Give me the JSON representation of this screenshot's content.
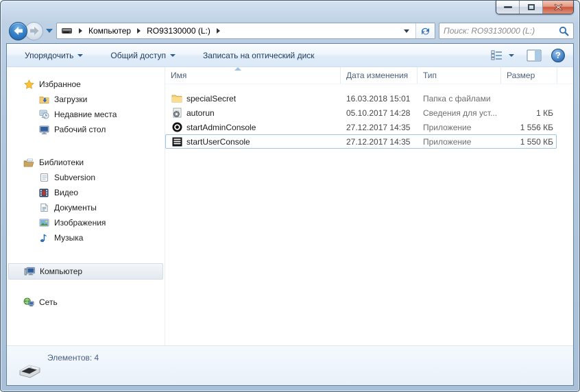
{
  "window": {
    "controls": {
      "minimize": "minimize",
      "maximize": "maximize",
      "close": "close"
    }
  },
  "nav": {
    "breadcrumb": {
      "items": [
        "Компьютер",
        "RO93130000 (L:)"
      ]
    },
    "search": {
      "placeholder": "Поиск: RO93130000 (L:)"
    }
  },
  "toolbar": {
    "organize_label": "Упорядочить",
    "share_label": "Общий доступ",
    "burn_label": "Записать на оптический диск"
  },
  "sidebar": {
    "sections": [
      {
        "label": "Избранное",
        "icon": "star-icon",
        "items": [
          {
            "label": "Загрузки",
            "icon": "downloads-icon"
          },
          {
            "label": "Недавние места",
            "icon": "recent-places-icon"
          },
          {
            "label": "Рабочий стол",
            "icon": "desktop-icon"
          }
        ]
      },
      {
        "label": "Библиотеки",
        "icon": "libraries-icon",
        "items": [
          {
            "label": "Subversion",
            "icon": "subversion-icon"
          },
          {
            "label": "Видео",
            "icon": "video-icon"
          },
          {
            "label": "Документы",
            "icon": "documents-icon"
          },
          {
            "label": "Изображения",
            "icon": "pictures-icon"
          },
          {
            "label": "Музыка",
            "icon": "music-icon"
          }
        ]
      },
      {
        "label": "Компьютер",
        "icon": "computer-icon",
        "selected": true,
        "items": []
      },
      {
        "label": "Сеть",
        "icon": "network-icon",
        "items": []
      }
    ]
  },
  "filelist": {
    "columns": {
      "name": "Имя",
      "date": "Дата изменения",
      "type": "Тип",
      "size": "Размер"
    },
    "sort": {
      "column": "Имя",
      "direction": "ascending"
    },
    "rows": [
      {
        "name": "specialSecret",
        "icon": "folder-icon",
        "date": "16.03.2018 15:01",
        "type": "Папка с файлами",
        "size": ""
      },
      {
        "name": "autorun",
        "icon": "setup-info-icon",
        "date": "05.10.2017 14:28",
        "type": "Сведения для уст...",
        "size": "1 КБ"
      },
      {
        "name": "startAdminConsole",
        "icon": "app-disc-icon",
        "date": "27.12.2017 14:35",
        "type": "Приложение",
        "size": "1 556 КБ"
      },
      {
        "name": "startUserConsole",
        "icon": "app-console-icon",
        "date": "27.12.2017 14:35",
        "type": "Приложение",
        "size": "1 550 КБ",
        "selected": true
      }
    ]
  },
  "statusbar": {
    "items_count": "Элементов: 4"
  },
  "colors": {
    "frame": "#b3c8de",
    "accent_blue": "#2e6da8",
    "selection_border": "#a4c3e0",
    "header_text": "#4c607a",
    "close_red": "#cc573d"
  }
}
